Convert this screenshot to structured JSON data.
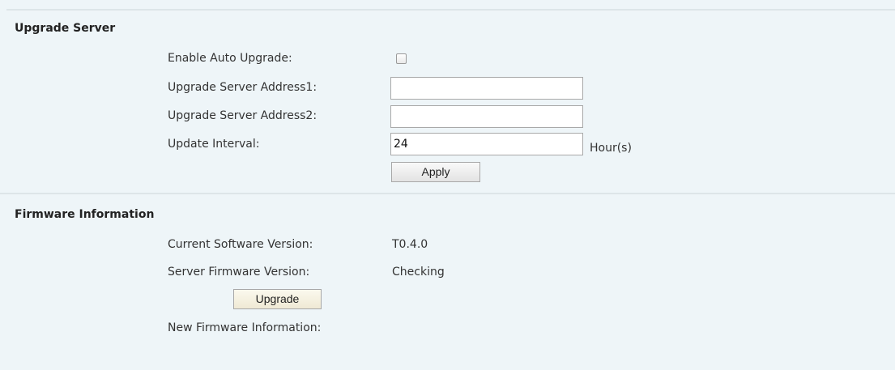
{
  "upgrade_server": {
    "title": "Upgrade Server",
    "enable_auto_upgrade_label": "Enable Auto Upgrade:",
    "enable_auto_upgrade_checked": false,
    "address1_label": "Upgrade Server Address1:",
    "address1_value": "",
    "address2_label": "Upgrade Server Address2:",
    "address2_value": "",
    "update_interval_label": "Update Interval:",
    "update_interval_value": "24",
    "update_interval_unit": "Hour(s)",
    "apply_label": "Apply"
  },
  "firmware_information": {
    "title": "Firmware Information",
    "current_version_label": "Current Software Version:",
    "current_version_value": "T0.4.0",
    "server_version_label": "Server Firmware Version:",
    "server_version_value": "Checking",
    "upgrade_label": "Upgrade",
    "new_firmware_label": "New Firmware Information:",
    "new_firmware_value": ""
  }
}
